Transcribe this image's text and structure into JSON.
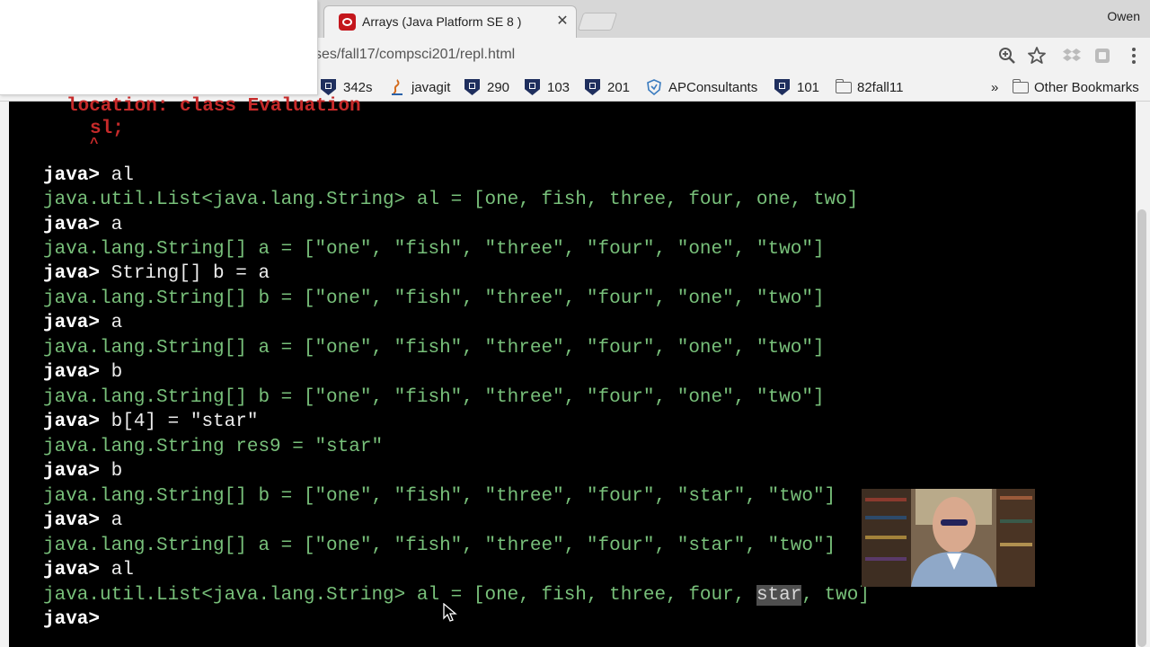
{
  "browser": {
    "tab_title": "Arrays (Java Platform SE 8 )",
    "tab_close": "✕",
    "profile_name": "Owen",
    "url": "ses/fall17/compsci201/repl.html"
  },
  "bookmarks": {
    "items": [
      "342s",
      "javagit",
      "290",
      "103",
      "201",
      "APConsultants",
      "101",
      "82fall11"
    ],
    "overflow": "»",
    "other": "Other Bookmarks"
  },
  "terminal": {
    "error_lines": [
      "location: class Evaluation",
      "sl;",
      "^"
    ],
    "prompt": "java>",
    "entries": [
      {
        "cmd": "al",
        "out": "java.util.List<java.lang.String> al = [one, fish, three, four, one, two]"
      },
      {
        "cmd": "a",
        "out": "java.lang.String[] a = [\"one\", \"fish\", \"three\", \"four\", \"one\", \"two\"]"
      },
      {
        "cmd": "String[] b = a",
        "out": "java.lang.String[] b = [\"one\", \"fish\", \"three\", \"four\", \"one\", \"two\"]"
      },
      {
        "cmd": "a",
        "out": "java.lang.String[] a = [\"one\", \"fish\", \"three\", \"four\", \"one\", \"two\"]"
      },
      {
        "cmd": "b",
        "out": "java.lang.String[] b = [\"one\", \"fish\", \"three\", \"four\", \"one\", \"two\"]"
      },
      {
        "cmd": "b[4] = \"star\"",
        "out": "java.lang.String res9 = \"star\""
      },
      {
        "cmd": "b",
        "out": "java.lang.String[] b = [\"one\", \"fish\", \"three\", \"four\", \"star\", \"two\"]"
      },
      {
        "cmd": "a",
        "out": "java.lang.String[] a = [\"one\", \"fish\", \"three\", \"four\", \"star\", \"two\"]"
      },
      {
        "cmd": "al",
        "out_before": "java.util.List<java.lang.String> al = [one, fish, three, four, ",
        "out_highlight": "star",
        "out_after": ", two]"
      }
    ],
    "final_prompt": "java>"
  }
}
